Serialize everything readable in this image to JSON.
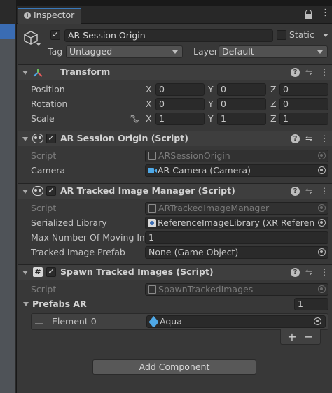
{
  "tab": {
    "title": "Inspector"
  },
  "object": {
    "name": "AR Session Origin",
    "active": true,
    "static_label": "Static",
    "tag_label": "Tag",
    "tag_value": "Untagged",
    "layer_label": "Layer",
    "layer_value": "Default"
  },
  "transform": {
    "title": "Transform",
    "rows": [
      {
        "label": "Position",
        "x": "0",
        "y": "0",
        "z": "0"
      },
      {
        "label": "Rotation",
        "x": "0",
        "y": "0",
        "z": "0"
      },
      {
        "label": "Scale",
        "x": "1",
        "y": "1",
        "z": "1"
      }
    ],
    "axis_x": "X",
    "axis_y": "Y",
    "axis_z": "Z"
  },
  "session_origin": {
    "title": "AR Session Origin (Script)",
    "script_label": "Script",
    "script_value": "ARSessionOrigin",
    "camera_label": "Camera",
    "camera_value": "AR Camera (Camera)"
  },
  "tracked_image_manager": {
    "title": "AR Tracked Image Manager (Script)",
    "script_label": "Script",
    "script_value": "ARTrackedImageManager",
    "library_label": "Serialized Library",
    "library_value": "ReferenceImageLibrary (XR Reference I",
    "max_label": "Max Number Of Moving Images",
    "max_value": "1",
    "prefab_label": "Tracked Image Prefab",
    "prefab_value": "None (Game Object)"
  },
  "spawn_tracked_images": {
    "title": "Spawn Tracked Images (Script)",
    "script_label": "Script",
    "script_value": "SpawnTrackedImages",
    "prefabs_label": "Prefabs AR",
    "prefabs_count": "1",
    "element_label": "Element 0",
    "element_value": "Aqua",
    "add_symbol": "+",
    "remove_symbol": "−"
  },
  "add_component": {
    "label": "Add Component"
  },
  "colors": {
    "accent": "#3a79bb",
    "camera_icon": "#4fa8e6",
    "panel": "#383838",
    "header": "#3e3e3e"
  }
}
